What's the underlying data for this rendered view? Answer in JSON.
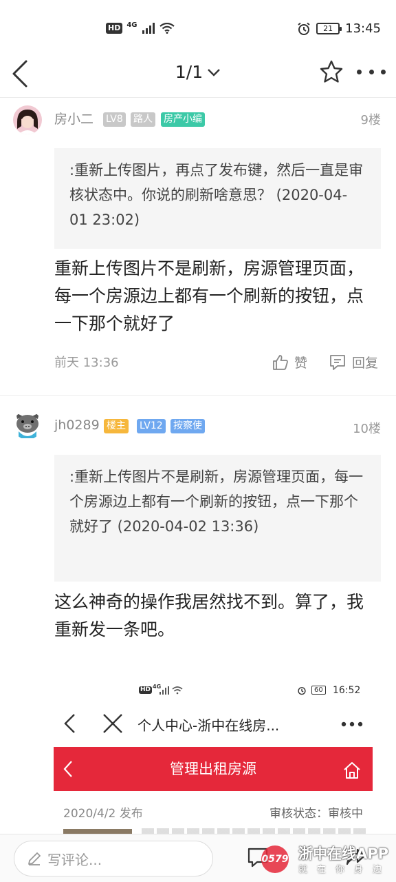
{
  "status_bar": {
    "hd": "HD",
    "network": "4G",
    "battery": "21",
    "time": "13:45"
  },
  "nav": {
    "title": "1/1",
    "icons": [
      "back-icon",
      "chevron-down-icon",
      "star-icon",
      "more-icon"
    ]
  },
  "comments": [
    {
      "username": "房小二",
      "badges": [
        {
          "text": "LV8",
          "color": "#c8c8c8"
        },
        {
          "text": "路人",
          "color": "#c8c8c8"
        },
        {
          "text": "房产小编",
          "color": "#3cc9a7"
        }
      ],
      "floor": "9楼",
      "quote": ":重新上传图片，再点了发布键，然后一直是审核状态中。你说的刷新啥意思？ (2020-04-01 23:02)",
      "body": "重新上传图片不是刷新，房源管理页面，每一个房源边上都有一个刷新的按钮，点一下那个就好了",
      "time": "前天 13:36",
      "like_label": "赞",
      "reply_label": "回复"
    },
    {
      "username": "jh0289",
      "badges": [
        {
          "text": "楼主",
          "color": "#f6b73c"
        },
        {
          "text": "LV12",
          "color": "#6fa8f0"
        },
        {
          "text": "按察使",
          "color": "#6fa8f0"
        }
      ],
      "floor": "10楼",
      "quote": ":重新上传图片不是刷新，房源管理页面，每一个房源边上都有一个刷新的按钮，点一下那个就好了 (2020-04-02 13:36)",
      "body": "这么神奇的操作我居然找不到。算了，我重新发一条吧。"
    }
  ],
  "embedded_screenshot": {
    "status_hd": "HD",
    "status_net": "4G",
    "battery": "60",
    "time": "16:52",
    "title": "个人中心-浙中在线房...",
    "header": "管理出租房源",
    "date": "2020/4/2 发布",
    "review_status": "审核状态：审核中"
  },
  "bottom_bar": {
    "comment_placeholder": "写评论...",
    "watermark_title": "浙中在线APP",
    "watermark_sub": "就在你身边",
    "watermark_logo": "0579",
    "colors": {
      "accent_red": "#e5283a"
    }
  }
}
